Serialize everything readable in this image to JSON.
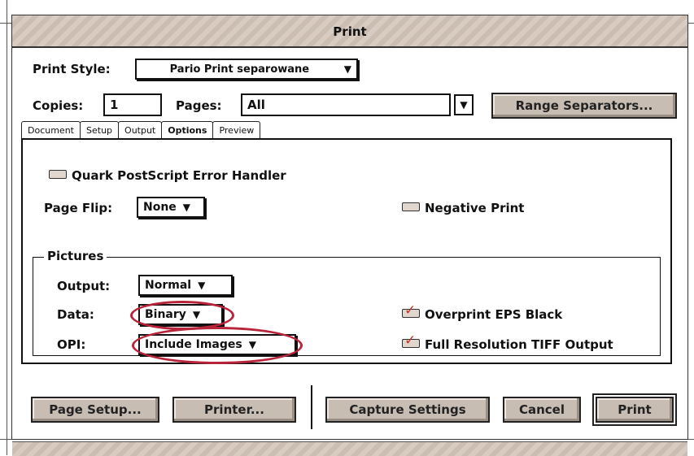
{
  "window": {
    "title": "Print"
  },
  "print_style": {
    "label": "Print Style:",
    "value": "Pario Print separowane"
  },
  "copies": {
    "label": "Copies:",
    "value": "1"
  },
  "pages": {
    "label": "Pages:",
    "value": "All"
  },
  "range_separators_label": "Range Separators...",
  "tabs": [
    "Document",
    "Setup",
    "Output",
    "Options",
    "Preview"
  ],
  "active_tab": "Options",
  "options": {
    "error_handler": {
      "label": "Quark PostScript Error Handler",
      "checked": false
    },
    "page_flip": {
      "label": "Page Flip:",
      "value": "None"
    },
    "negative_print": {
      "label": "Negative Print",
      "checked": false
    }
  },
  "pictures": {
    "title": "Pictures",
    "output": {
      "label": "Output:",
      "value": "Normal"
    },
    "data": {
      "label": "Data:",
      "value": "Binary"
    },
    "opi": {
      "label": "OPI:",
      "value": "Include Images"
    },
    "overprint": {
      "label": "Overprint EPS Black",
      "checked": true
    },
    "full_res": {
      "label": "Full Resolution TIFF Output",
      "checked": true
    }
  },
  "buttons": {
    "page_setup": "Page Setup...",
    "printer": "Printer...",
    "capture_settings": "Capture Settings",
    "cancel": "Cancel",
    "print": "Print"
  },
  "icons": {
    "popup_arrow": "triangle-down-icon",
    "check": "checkmark-icon"
  },
  "colors": {
    "accent_annotation": "#b8243a",
    "button_face": "#c7bdb3"
  }
}
